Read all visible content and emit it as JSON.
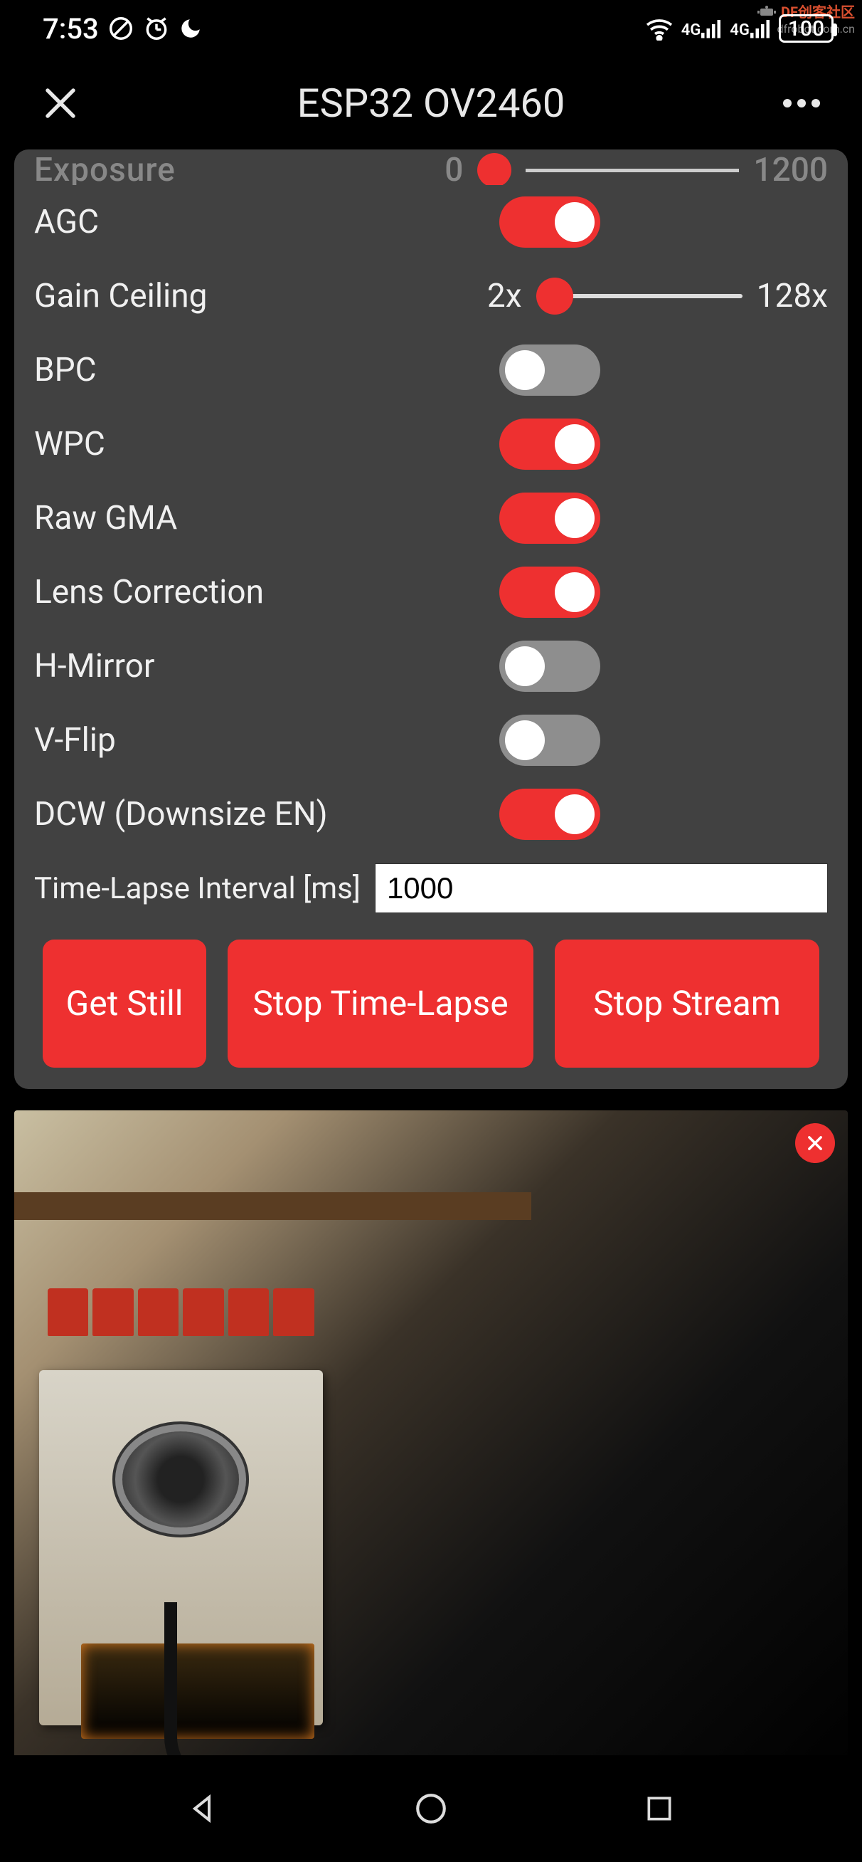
{
  "status": {
    "time": "7:53",
    "network_label_1": "4G",
    "network_label_2": "4G",
    "battery": "100"
  },
  "watermark": {
    "line1": "DF创客社区",
    "line2": "dfrobot.com.cn"
  },
  "header": {
    "title": "ESP32 OV2460"
  },
  "settings": {
    "exposure": {
      "label": "Exposure",
      "min": "0",
      "max": "1200"
    },
    "agc": {
      "label": "AGC",
      "on": true
    },
    "gain_ceiling": {
      "label": "Gain Ceiling",
      "min": "2x",
      "max": "128x"
    },
    "bpc": {
      "label": "BPC",
      "on": false
    },
    "wpc": {
      "label": "WPC",
      "on": true
    },
    "raw_gma": {
      "label": "Raw GMA",
      "on": true
    },
    "lens_correction": {
      "label": "Lens Correction",
      "on": true
    },
    "h_mirror": {
      "label": "H-Mirror",
      "on": false
    },
    "v_flip": {
      "label": "V-Flip",
      "on": false
    },
    "dcw": {
      "label": "DCW (Downsize EN)",
      "on": true
    },
    "time_lapse": {
      "label": "Time-Lapse Interval [ms]",
      "value": "1000"
    }
  },
  "buttons": {
    "get_still": "Get Still",
    "stop_timelapse": "Stop Time-Lapse",
    "stop_stream": "Stop Stream"
  }
}
